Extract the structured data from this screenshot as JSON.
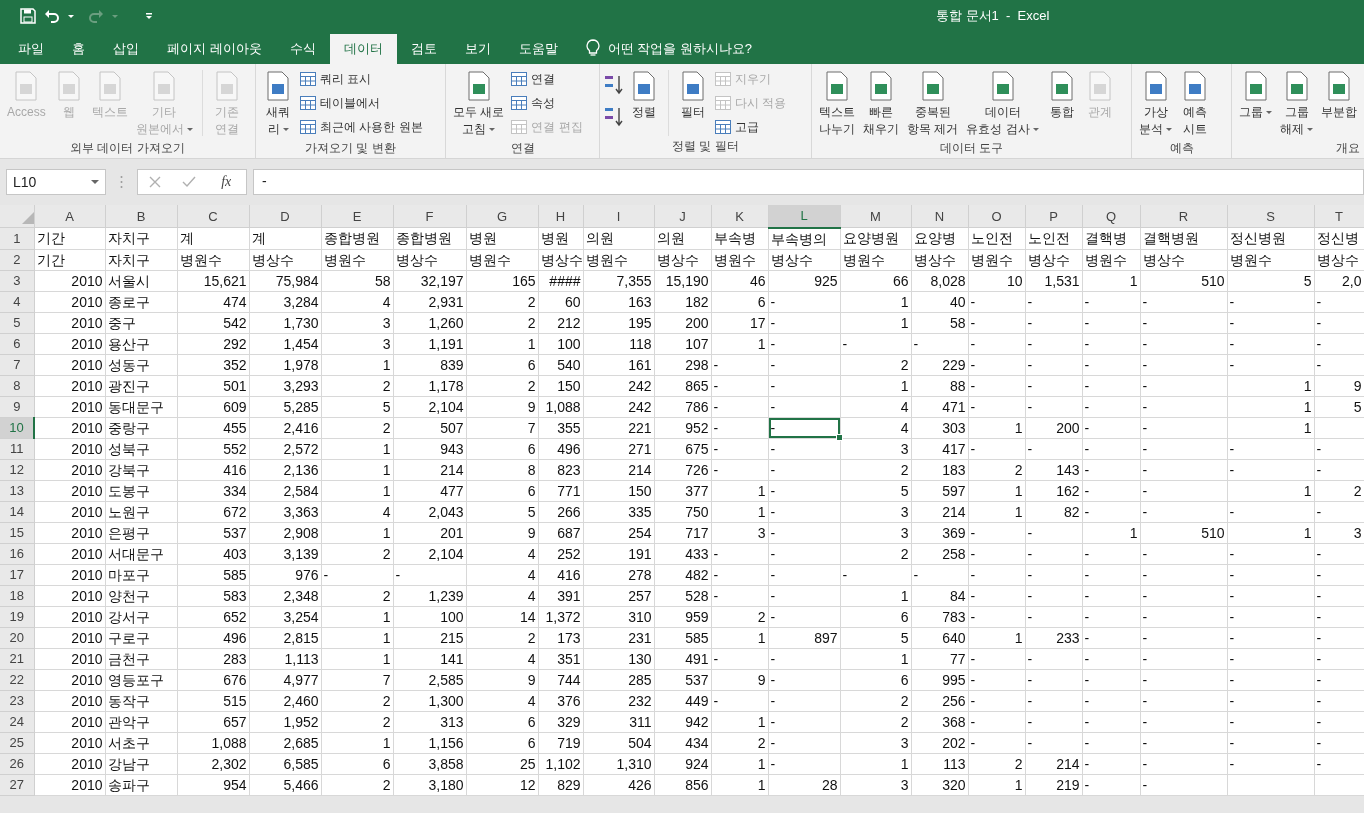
{
  "title_bar": {
    "title": "통합 문서1  -  Excel"
  },
  "tabs": [
    {
      "label": "파일",
      "selected": false
    },
    {
      "label": "홈",
      "selected": false
    },
    {
      "label": "삽입",
      "selected": false
    },
    {
      "label": "페이지 레이아웃",
      "selected": false
    },
    {
      "label": "수식",
      "selected": false
    },
    {
      "label": "데이터",
      "selected": true
    },
    {
      "label": "검토",
      "selected": false
    },
    {
      "label": "보기",
      "selected": false
    },
    {
      "label": "도움말",
      "selected": false
    }
  ],
  "tell_me": "어떤 작업을 원하시나요?",
  "ribbon": [
    {
      "label": "외부 데이터 가져오기",
      "items": [
        {
          "kind": "large",
          "lines": [
            "Access"
          ],
          "disabled": true,
          "dropdown": false
        },
        {
          "kind": "large",
          "lines": [
            "웹"
          ],
          "disabled": true,
          "dropdown": false
        },
        {
          "kind": "large",
          "lines": [
            "텍스트"
          ],
          "disabled": true,
          "dropdown": false
        },
        {
          "kind": "large",
          "lines": [
            "기타",
            "원본에서"
          ],
          "disabled": true,
          "dropdown": true
        },
        {
          "kind": "separator"
        },
        {
          "kind": "large",
          "lines": [
            "기존",
            "연결"
          ],
          "disabled": true,
          "dropdown": false
        }
      ]
    },
    {
      "label": "가져오기 및 변환",
      "items": [
        {
          "kind": "large",
          "lines": [
            "새쿼",
            "리"
          ],
          "disabled": false,
          "dropdown": true
        },
        {
          "kind": "stack",
          "items": [
            {
              "label": "쿼리 표시",
              "disabled": false
            },
            {
              "label": "테이블에서",
              "disabled": false
            },
            {
              "label": "최근에 사용한 원본",
              "disabled": false
            }
          ]
        }
      ]
    },
    {
      "label": "연결",
      "items": [
        {
          "kind": "large",
          "lines": [
            "모두 새로",
            "고침"
          ],
          "disabled": false,
          "dropdown": true
        },
        {
          "kind": "stack",
          "items": [
            {
              "label": "연결",
              "disabled": false
            },
            {
              "label": "속성",
              "disabled": false
            },
            {
              "label": "연결 편집",
              "disabled": true
            }
          ]
        }
      ]
    },
    {
      "label": "정렬 및 필터",
      "items": [
        {
          "kind": "sort"
        },
        {
          "kind": "large",
          "lines": [
            "정렬"
          ],
          "disabled": false,
          "dropdown": false
        },
        {
          "kind": "separator"
        },
        {
          "kind": "large",
          "lines": [
            "필터"
          ],
          "disabled": false,
          "dropdown": false
        },
        {
          "kind": "stack",
          "items": [
            {
              "label": "지우기",
              "disabled": true
            },
            {
              "label": "다시 적용",
              "disabled": true
            },
            {
              "label": "고급",
              "disabled": false
            }
          ]
        }
      ]
    },
    {
      "label": "데이터 도구",
      "items": [
        {
          "kind": "large",
          "lines": [
            "텍스트",
            "나누기"
          ],
          "disabled": false,
          "dropdown": false
        },
        {
          "kind": "large",
          "lines": [
            "빠른",
            "채우기"
          ],
          "disabled": false,
          "dropdown": false
        },
        {
          "kind": "large",
          "lines": [
            "중복된",
            "항목 제거"
          ],
          "disabled": false,
          "dropdown": false
        },
        {
          "kind": "large",
          "lines": [
            "데이터",
            "유효성 검사"
          ],
          "disabled": false,
          "dropdown": true
        },
        {
          "kind": "large",
          "lines": [
            "통합"
          ],
          "disabled": false,
          "dropdown": false
        },
        {
          "kind": "large",
          "lines": [
            "관계"
          ],
          "disabled": true,
          "dropdown": false
        }
      ]
    },
    {
      "label": "예측",
      "items": [
        {
          "kind": "large",
          "lines": [
            "가상",
            "분석"
          ],
          "disabled": false,
          "dropdown": true
        },
        {
          "kind": "large",
          "lines": [
            "예측",
            "시트"
          ],
          "disabled": false,
          "dropdown": false
        }
      ]
    },
    {
      "label": "개요",
      "items": [
        {
          "kind": "large",
          "lines": [
            "그룹"
          ],
          "disabled": false,
          "dropdown": true
        },
        {
          "kind": "large",
          "lines": [
            "그룹",
            "해제"
          ],
          "disabled": false,
          "dropdown": true
        },
        {
          "kind": "large",
          "lines": [
            "부분합"
          ],
          "disabled": false,
          "dropdown": false
        }
      ]
    }
  ],
  "formula_bar": {
    "name_box": "L10",
    "function_label": "fx",
    "value": "-"
  },
  "grid": {
    "columns": [
      {
        "letter": "A",
        "selected": false
      },
      {
        "letter": "B",
        "selected": false
      },
      {
        "letter": "C",
        "selected": false
      },
      {
        "letter": "D",
        "selected": false
      },
      {
        "letter": "E",
        "selected": false
      },
      {
        "letter": "F",
        "selected": false
      },
      {
        "letter": "G",
        "selected": false
      },
      {
        "letter": "H",
        "selected": false
      },
      {
        "letter": "I",
        "selected": false
      },
      {
        "letter": "J",
        "selected": false
      },
      {
        "letter": "K",
        "selected": false
      },
      {
        "letter": "L",
        "selected": true
      },
      {
        "letter": "M",
        "selected": false
      },
      {
        "letter": "N",
        "selected": false
      },
      {
        "letter": "O",
        "selected": false
      },
      {
        "letter": "P",
        "selected": false
      },
      {
        "letter": "Q",
        "selected": false
      },
      {
        "letter": "R",
        "selected": false
      },
      {
        "letter": "S",
        "selected": false
      },
      {
        "letter": "T",
        "selected": false
      }
    ],
    "rows": [
      {
        "number": "1",
        "selected": false,
        "cells": [
          "기간",
          "자치구",
          "계",
          "계",
          "종합병원",
          "종합병원",
          "병원",
          "병원",
          "의원",
          "의원",
          "부속병",
          "부속병의",
          "요양병원",
          "요양병",
          "노인전",
          "노인전",
          "결핵병",
          "결핵병원",
          "정신병원",
          "정신병"
        ]
      },
      {
        "number": "2",
        "selected": false,
        "cells": [
          "기간",
          "자치구",
          "병원수",
          "병상수",
          "병원수",
          "병상수",
          "병원수",
          "병상수",
          "병원수",
          "병상수",
          "병원수",
          "병상수",
          "병원수",
          "병상수",
          "병원수",
          "병상수",
          "병원수",
          "병상수",
          "병원수",
          "병상수"
        ]
      },
      {
        "number": "3",
        "selected": false,
        "cells": [
          "2010",
          "서울시",
          "15,621",
          "75,984",
          "58",
          "32,197",
          "165",
          "####",
          "7,355",
          "15,190",
          "46",
          "925",
          "66",
          "8,028",
          "10",
          "1,531",
          "1",
          "510",
          "5",
          "2,0"
        ]
      },
      {
        "number": "4",
        "selected": false,
        "cells": [
          "2010",
          "종로구",
          "474",
          "3,284",
          "4",
          "2,931",
          "2",
          "60",
          "163",
          "182",
          "6",
          "-",
          "1",
          "40",
          "-",
          "-",
          "-",
          "-",
          "-",
          "-"
        ]
      },
      {
        "number": "5",
        "selected": false,
        "cells": [
          "2010",
          "중구",
          "542",
          "1,730",
          "3",
          "1,260",
          "2",
          "212",
          "195",
          "200",
          "17",
          "-",
          "1",
          "58",
          "-",
          "-",
          "-",
          "-",
          "-",
          "-"
        ]
      },
      {
        "number": "6",
        "selected": false,
        "cells": [
          "2010",
          "용산구",
          "292",
          "1,454",
          "3",
          "1,191",
          "1",
          "100",
          "118",
          "107",
          "1",
          "-",
          "-",
          "-",
          "-",
          "-",
          "-",
          "-",
          "-",
          "-"
        ]
      },
      {
        "number": "7",
        "selected": false,
        "cells": [
          "2010",
          "성동구",
          "352",
          "1,978",
          "1",
          "839",
          "6",
          "540",
          "161",
          "298",
          "-",
          "-",
          "2",
          "229",
          "-",
          "-",
          "-",
          "-",
          "-",
          "-"
        ]
      },
      {
        "number": "8",
        "selected": false,
        "cells": [
          "2010",
          "광진구",
          "501",
          "3,293",
          "2",
          "1,178",
          "2",
          "150",
          "242",
          "865",
          "-",
          "-",
          "1",
          "88",
          "-",
          "-",
          "-",
          "-",
          "1",
          "9"
        ]
      },
      {
        "number": "9",
        "selected": false,
        "cells": [
          "2010",
          "동대문구",
          "609",
          "5,285",
          "5",
          "2,104",
          "9",
          "1,088",
          "242",
          "786",
          "-",
          "-",
          "4",
          "471",
          "-",
          "-",
          "-",
          "-",
          "1",
          "5"
        ]
      },
      {
        "number": "10",
        "selected": true,
        "cells": [
          "2010",
          "중랑구",
          "455",
          "2,416",
          "2",
          "507",
          "7",
          "355",
          "221",
          "952",
          "-",
          "-",
          "4",
          "303",
          "1",
          "200",
          "-",
          "-",
          "1"
        ]
      },
      {
        "number": "11",
        "selected": false,
        "cells": [
          "2010",
          "성북구",
          "552",
          "2,572",
          "1",
          "943",
          "6",
          "496",
          "271",
          "675",
          "-",
          "-",
          "3",
          "417",
          "-",
          "-",
          "-",
          "-",
          "-",
          "-"
        ]
      },
      {
        "number": "12",
        "selected": false,
        "cells": [
          "2010",
          "강북구",
          "416",
          "2,136",
          "1",
          "214",
          "8",
          "823",
          "214",
          "726",
          "-",
          "-",
          "2",
          "183",
          "2",
          "143",
          "-",
          "-",
          "-",
          "-"
        ]
      },
      {
        "number": "13",
        "selected": false,
        "cells": [
          "2010",
          "도봉구",
          "334",
          "2,584",
          "1",
          "477",
          "6",
          "771",
          "150",
          "377",
          "1",
          "-",
          "5",
          "597",
          "1",
          "162",
          "-",
          "-",
          "1",
          "2"
        ]
      },
      {
        "number": "14",
        "selected": false,
        "cells": [
          "2010",
          "노원구",
          "672",
          "3,363",
          "4",
          "2,043",
          "5",
          "266",
          "335",
          "750",
          "1",
          "-",
          "3",
          "214",
          "1",
          "82",
          "-",
          "-",
          "-",
          "-"
        ]
      },
      {
        "number": "15",
        "selected": false,
        "cells": [
          "2010",
          "은평구",
          "537",
          "2,908",
          "1",
          "201",
          "9",
          "687",
          "254",
          "717",
          "3",
          "-",
          "3",
          "369",
          "-",
          "-",
          "1",
          "510",
          "1",
          "3"
        ]
      },
      {
        "number": "16",
        "selected": false,
        "cells": [
          "2010",
          "서대문구",
          "403",
          "3,139",
          "2",
          "2,104",
          "4",
          "252",
          "191",
          "433",
          "-",
          "-",
          "2",
          "258",
          "-",
          "-",
          "-",
          "-",
          "-",
          "-"
        ]
      },
      {
        "number": "17",
        "selected": false,
        "cells": [
          "2010",
          "마포구",
          "585",
          "976",
          "-",
          "-",
          "4",
          "416",
          "278",
          "482",
          "-",
          "-",
          "-",
          "-",
          "-",
          "-",
          "-",
          "-",
          "-",
          "-"
        ]
      },
      {
        "number": "18",
        "selected": false,
        "cells": [
          "2010",
          "양천구",
          "583",
          "2,348",
          "2",
          "1,239",
          "4",
          "391",
          "257",
          "528",
          "-",
          "-",
          "1",
          "84",
          "-",
          "-",
          "-",
          "-",
          "-",
          "-"
        ]
      },
      {
        "number": "19",
        "selected": false,
        "cells": [
          "2010",
          "강서구",
          "652",
          "3,254",
          "1",
          "100",
          "14",
          "1,372",
          "310",
          "959",
          "2",
          "-",
          "6",
          "783",
          "-",
          "-",
          "-",
          "-",
          "-",
          "-"
        ]
      },
      {
        "number": "20",
        "selected": false,
        "cells": [
          "2010",
          "구로구",
          "496",
          "2,815",
          "1",
          "215",
          "2",
          "173",
          "231",
          "585",
          "1",
          "897",
          "5",
          "640",
          "1",
          "233",
          "-",
          "-",
          "-",
          "-"
        ]
      },
      {
        "number": "21",
        "selected": false,
        "cells": [
          "2010",
          "금천구",
          "283",
          "1,113",
          "1",
          "141",
          "4",
          "351",
          "130",
          "491",
          "-",
          "-",
          "1",
          "77",
          "-",
          "-",
          "-",
          "-",
          "-",
          "-"
        ]
      },
      {
        "number": "22",
        "selected": false,
        "cells": [
          "2010",
          "영등포구",
          "676",
          "4,977",
          "7",
          "2,585",
          "9",
          "744",
          "285",
          "537",
          "9",
          "-",
          "6",
          "995",
          "-",
          "-",
          "-",
          "-",
          "-",
          "-"
        ]
      },
      {
        "number": "23",
        "selected": false,
        "cells": [
          "2010",
          "동작구",
          "515",
          "2,460",
          "2",
          "1,300",
          "4",
          "376",
          "232",
          "449",
          "-",
          "-",
          "2",
          "256",
          "-",
          "-",
          "-",
          "-",
          "-",
          "-"
        ]
      },
      {
        "number": "24",
        "selected": false,
        "cells": [
          "2010",
          "관악구",
          "657",
          "1,952",
          "2",
          "313",
          "6",
          "329",
          "311",
          "942",
          "1",
          "-",
          "2",
          "368",
          "-",
          "-",
          "-",
          "-",
          "-",
          "-"
        ]
      },
      {
        "number": "25",
        "selected": false,
        "cells": [
          "2010",
          "서초구",
          "1,088",
          "2,685",
          "1",
          "1,156",
          "6",
          "719",
          "504",
          "434",
          "2",
          "-",
          "3",
          "202",
          "-",
          "-",
          "-",
          "-",
          "-",
          "-"
        ]
      },
      {
        "number": "26",
        "selected": false,
        "cells": [
          "2010",
          "강남구",
          "2,302",
          "6,585",
          "6",
          "3,858",
          "25",
          "1,102",
          "1,310",
          "924",
          "1",
          "-",
          "1",
          "113",
          "2",
          "214",
          "-",
          "-",
          "-",
          "-"
        ]
      },
      {
        "number": "27",
        "selected": false,
        "cells": [
          "2010",
          "송파구",
          "954",
          "5,466",
          "2",
          "3,180",
          "12",
          "829",
          "426",
          "856",
          "1",
          "28",
          "3",
          "320",
          "1",
          "219",
          "-",
          "-"
        ]
      }
    ]
  }
}
